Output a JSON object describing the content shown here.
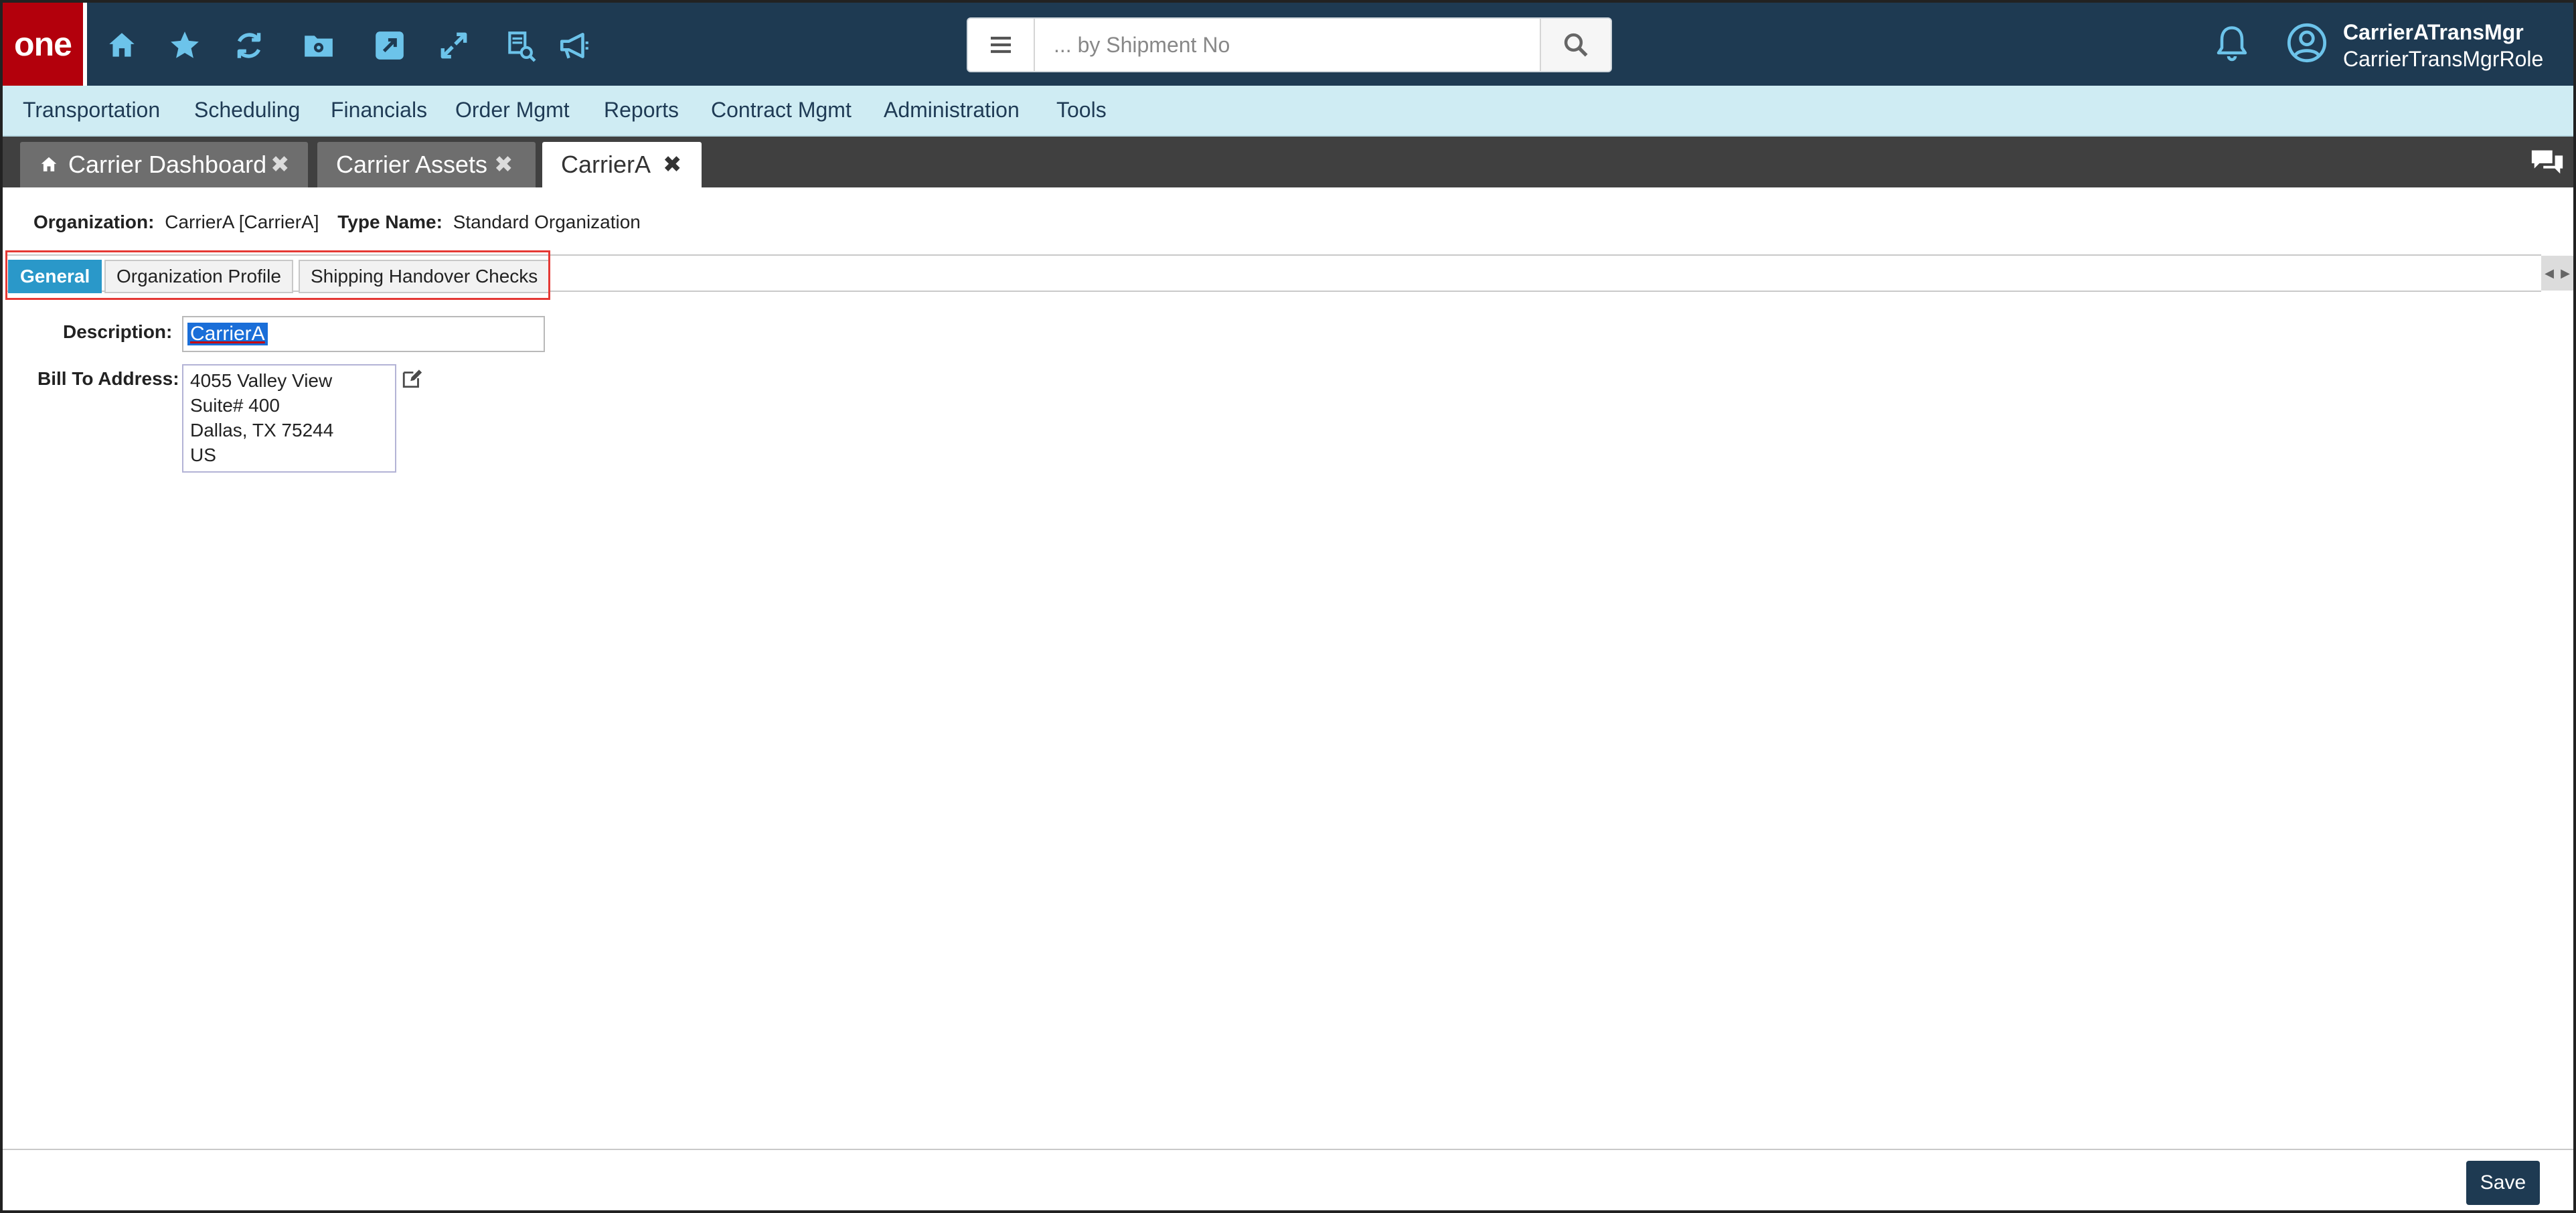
{
  "app": {
    "logo_text": "one",
    "brand_color": "#b3000c",
    "header_color": "#1e3a52"
  },
  "toolbar": {
    "icons": [
      "home-icon",
      "star-icon",
      "refresh-icon",
      "folder-settings-icon",
      "external-link-icon",
      "expand-icon",
      "search-book-icon",
      "megaphone-icon"
    ]
  },
  "search": {
    "placeholder": "... by Shipment No",
    "value": ""
  },
  "user": {
    "name": "CarrierATransMgr",
    "role": "CarrierTransMgrRole"
  },
  "menu": {
    "items": [
      "Transportation",
      "Scheduling",
      "Financials",
      "Order Mgmt",
      "Reports",
      "Contract Mgmt",
      "Administration",
      "Tools"
    ]
  },
  "window_tabs": [
    {
      "label": "Carrier Dashboard",
      "has_home_icon": true,
      "active": false
    },
    {
      "label": "Carrier Assets",
      "active": false
    },
    {
      "label": "CarrierA",
      "active": true
    }
  ],
  "org": {
    "org_label": "Organization:",
    "org_value": "CarrierA [CarrierA]",
    "type_label": "Type Name:",
    "type_value": "Standard Organization"
  },
  "sub_tabs": [
    {
      "label": "General",
      "active": true
    },
    {
      "label": "Organization Profile",
      "active": false
    },
    {
      "label": "Shipping Handover Checks",
      "active": false
    }
  ],
  "form": {
    "description_label": "Description:",
    "description_value": "CarrierA",
    "bill_to_label": "Bill To Address:",
    "address_lines": [
      "4055 Valley View",
      "Suite# 400",
      "Dallas, TX 75244",
      "US"
    ]
  },
  "footer": {
    "save_label": "Save"
  },
  "colors": {
    "accent_tab": "#2a98c9",
    "menubar_bg": "#cfecf3",
    "highlight": "#e53935"
  }
}
